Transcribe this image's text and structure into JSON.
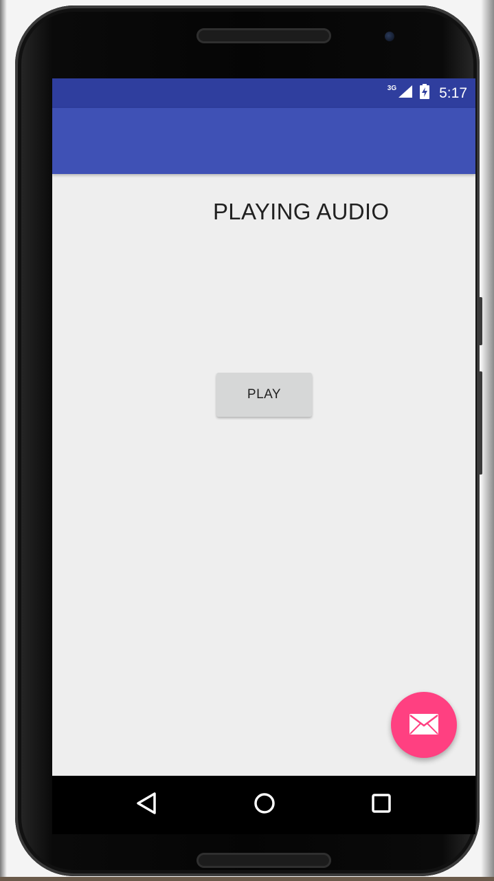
{
  "status_bar": {
    "network_type": "3G",
    "time": "5:17",
    "icons": [
      "signal-icon",
      "battery-charging-icon"
    ]
  },
  "app": {
    "title_text": "PLAYING AUDIO",
    "play_button_label": "PLAY",
    "fab_icon": "email-icon"
  },
  "navigation": {
    "buttons": [
      "back-icon",
      "home-icon",
      "recents-icon"
    ]
  },
  "colors": {
    "status_bar": "#2f3e9e",
    "app_bar": "#3f51b5",
    "fab": "#ff4081",
    "background": "#eeeeee"
  }
}
